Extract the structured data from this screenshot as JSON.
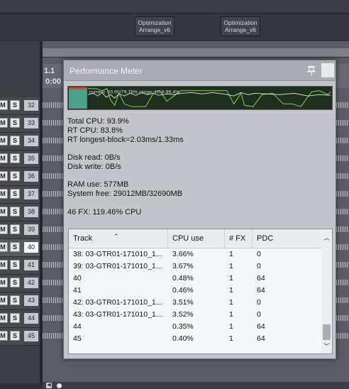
{
  "arrange": {
    "items": [
      {
        "line1": "Optimization",
        "line2": "Arrange_v6"
      },
      {
        "line1": "Optimization",
        "line2": "Arrange_v6"
      }
    ],
    "ruler_marks": [
      "1.1",
      "0:00"
    ],
    "tracks": [
      {
        "m": "M",
        "s": "S",
        "num": "32",
        "selected": false
      },
      {
        "m": "M",
        "s": "S",
        "num": "33",
        "selected": false
      },
      {
        "m": "M",
        "s": "S",
        "num": "34",
        "selected": false
      },
      {
        "m": "M",
        "s": "S",
        "num": "35",
        "selected": false
      },
      {
        "m": "M",
        "s": "S",
        "num": "36",
        "selected": false
      },
      {
        "m": "M",
        "s": "S",
        "num": "37",
        "selected": false
      },
      {
        "m": "M",
        "s": "S",
        "num": "38",
        "selected": false
      },
      {
        "m": "M",
        "s": "S",
        "num": "39",
        "selected": false
      },
      {
        "m": "M",
        "s": "S",
        "num": "40",
        "selected": true
      },
      {
        "m": "M",
        "s": "S",
        "num": "41",
        "selected": false
      },
      {
        "m": "M",
        "s": "S",
        "num": "42",
        "selected": false
      },
      {
        "m": "M",
        "s": "S",
        "num": "43",
        "selected": false
      },
      {
        "m": "M",
        "s": "S",
        "num": "44",
        "selected": false
      },
      {
        "m": "M",
        "s": "S",
        "num": "45",
        "selected": false
      }
    ]
  },
  "perf": {
    "title": "Performance Meter",
    "graph_text": "current: 93.90/79.78%  range: 10.8-99.4%",
    "stats": {
      "total_cpu": "Total CPU: 93.9%",
      "rt_cpu": "RT CPU: 83.8%",
      "rt_longest": "RT longest-block=2.03ms/1.33ms",
      "disk_read": "Disk read: 0B/s",
      "disk_write": "Disk write: 0B/s",
      "ram_use": "RAM use: 577MB",
      "system_free": "System free: 29012MB/32690MB",
      "fx": "46 FX: 119.46% CPU"
    },
    "list": {
      "headers": {
        "track": "Track",
        "cpu": "CPU use",
        "fx": "# FX",
        "pdc": "PDC"
      },
      "rows": [
        {
          "track": "38: 03-GTR01-171010_1...",
          "cpu": "3.66%",
          "fx": "1",
          "pdc": "0"
        },
        {
          "track": "39: 03-GTR01-171010_1...",
          "cpu": "3.67%",
          "fx": "1",
          "pdc": "0"
        },
        {
          "track": "40",
          "cpu": "0.48%",
          "fx": "1",
          "pdc": "64"
        },
        {
          "track": "41",
          "cpu": "0.46%",
          "fx": "1",
          "pdc": "64"
        },
        {
          "track": "42: 03-GTR01-171010_1...",
          "cpu": "3.51%",
          "fx": "1",
          "pdc": "0"
        },
        {
          "track": "43: 03-GTR01-171010_1...",
          "cpu": "3.52%",
          "fx": "1",
          "pdc": "0"
        },
        {
          "track": "44",
          "cpu": "0.35%",
          "fx": "1",
          "pdc": "64"
        },
        {
          "track": "45",
          "cpu": "0.40%",
          "fx": "1",
          "pdc": "64"
        }
      ]
    }
  }
}
